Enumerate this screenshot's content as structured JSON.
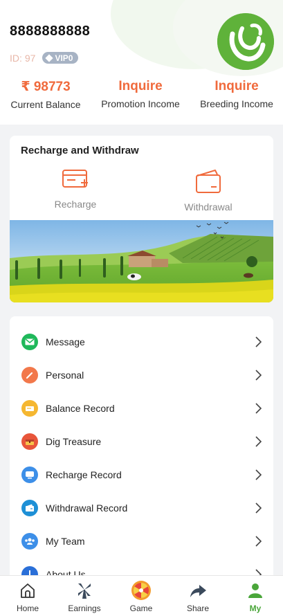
{
  "user": {
    "name": "8888888888",
    "id_label": "ID:",
    "id_value": "97",
    "vip": "VIP0"
  },
  "stats": [
    {
      "value": "₹ 98773",
      "label": "Current Balance"
    },
    {
      "value": "Inquire",
      "label": "Promotion Income"
    },
    {
      "value": "Inquire",
      "label": "Breeding Income"
    }
  ],
  "recharge_withdraw": {
    "title": "Recharge and Withdraw",
    "recharge": "Recharge",
    "withdrawal": "Withdrawal"
  },
  "menu": [
    {
      "label": "Message",
      "icon": "message-icon",
      "color": "#1fb85a"
    },
    {
      "label": "Personal",
      "icon": "pencil-icon",
      "color": "#f2784b"
    },
    {
      "label": "Balance Record",
      "icon": "balance-icon",
      "color": "#f5b731"
    },
    {
      "label": "Dig Treasure",
      "icon": "treasure-icon",
      "color": "#e8553a"
    },
    {
      "label": "Recharge Record",
      "icon": "recharge-record-icon",
      "color": "#3d8fe8"
    },
    {
      "label": "Withdrawal Record",
      "icon": "withdrawal-record-icon",
      "color": "#1e90d6"
    },
    {
      "label": "My Team",
      "icon": "team-icon",
      "color": "#3d8fe8"
    },
    {
      "label": "About Us",
      "icon": "info-icon",
      "color": "#2a6fd8"
    }
  ],
  "tabs": [
    {
      "label": "Home",
      "icon": "home-icon"
    },
    {
      "label": "Earnings",
      "icon": "windmill-icon"
    },
    {
      "label": "Game",
      "icon": "wheel-icon"
    },
    {
      "label": "Share",
      "icon": "share-icon"
    },
    {
      "label": "My",
      "icon": "person-icon",
      "active": true
    }
  ],
  "colors": {
    "accent": "#f06a3c",
    "brand_green": "#5fb23a",
    "tab_active": "#4aa63a"
  }
}
